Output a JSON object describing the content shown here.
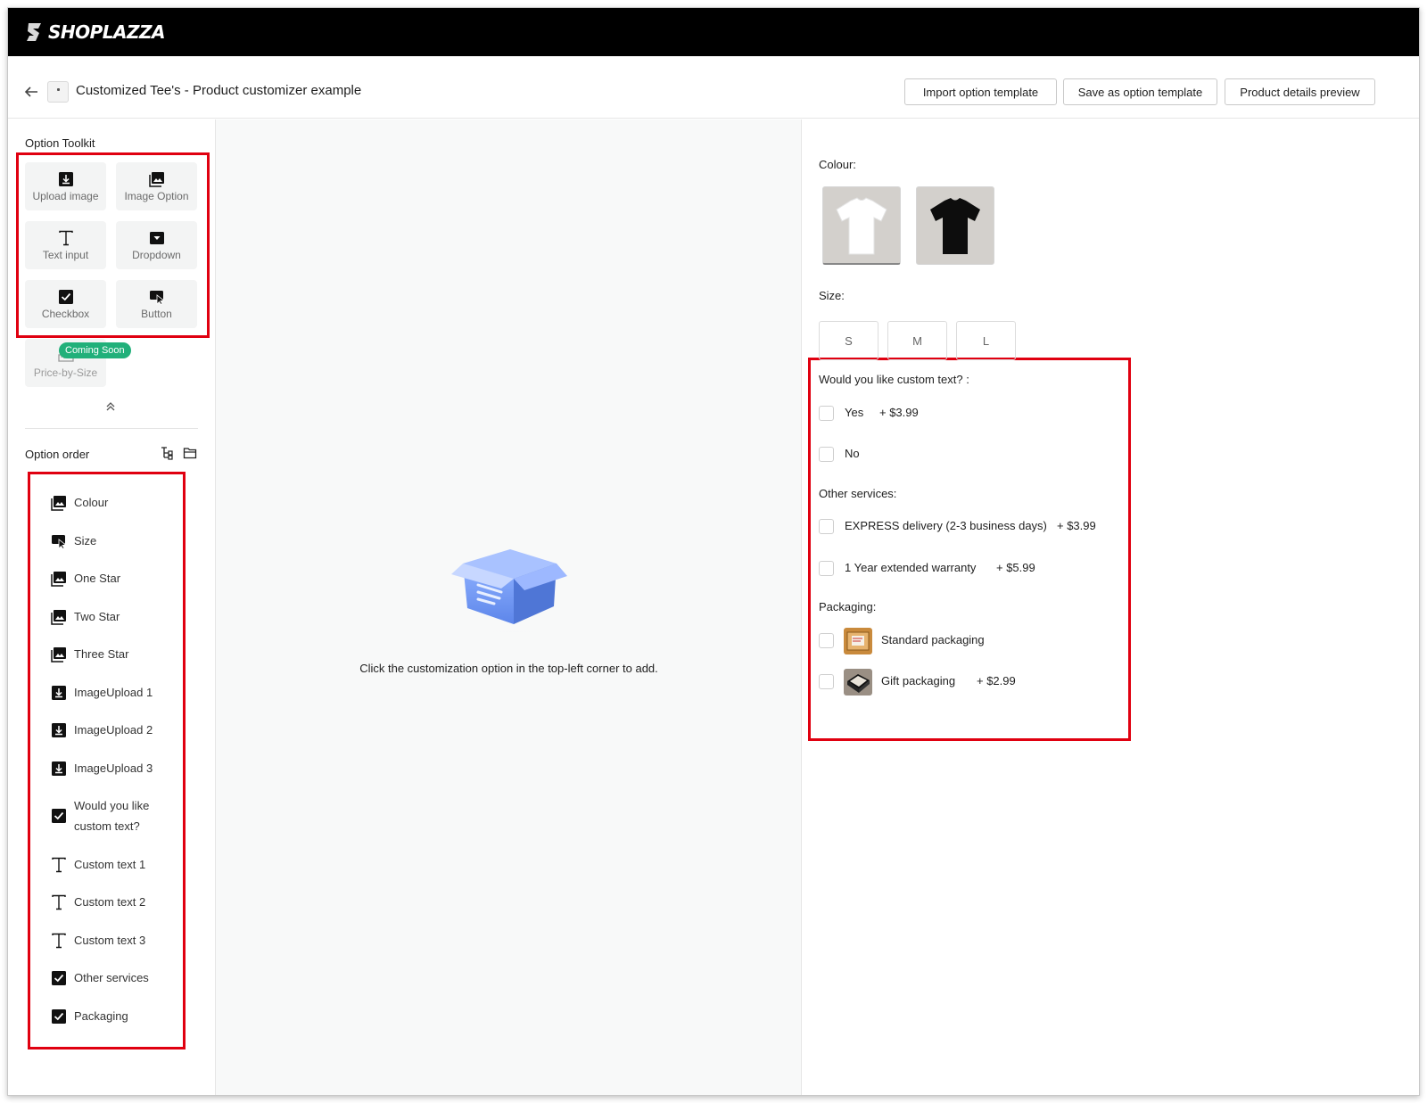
{
  "app": {
    "brand": "SHOPLAZZA",
    "page_title": "Customized Tee's - Product customizer example"
  },
  "header_buttons": {
    "import": "Import option template",
    "save": "Save as option template",
    "preview": "Product details preview"
  },
  "toolkit": {
    "title": "Option Toolkit",
    "tools": [
      {
        "label": "Upload image",
        "icon": "upload-image-icon"
      },
      {
        "label": "Image Option",
        "icon": "image-option-icon"
      },
      {
        "label": "Text input",
        "icon": "text-input-icon"
      },
      {
        "label": "Dropdown",
        "icon": "dropdown-icon"
      },
      {
        "label": "Checkbox",
        "icon": "checkbox-icon"
      },
      {
        "label": "Button",
        "icon": "button-cursor-icon"
      },
      {
        "label": "Price-by-Size",
        "icon": "ruler-icon"
      }
    ],
    "coming_soon": "Coming Soon"
  },
  "option_order": {
    "title": "Option order",
    "items": [
      {
        "label": "Colour",
        "icon": "image-option-icon"
      },
      {
        "label": "Size",
        "icon": "button-cursor-icon"
      },
      {
        "label": "One Star",
        "icon": "image-option-icon"
      },
      {
        "label": "Two Star",
        "icon": "image-option-icon"
      },
      {
        "label": "Three Star",
        "icon": "image-option-icon"
      },
      {
        "label": "ImageUpload 1",
        "icon": "upload-image-icon"
      },
      {
        "label": "ImageUpload 2",
        "icon": "upload-image-icon"
      },
      {
        "label": "ImageUpload 3",
        "icon": "upload-image-icon"
      },
      {
        "label": "Would you like custom text?",
        "icon": "checkbox-icon"
      },
      {
        "label": "Custom text 1",
        "icon": "text-input-icon"
      },
      {
        "label": "Custom text 2",
        "icon": "text-input-icon"
      },
      {
        "label": "Custom text 3",
        "icon": "text-input-icon"
      },
      {
        "label": "Other services",
        "icon": "checkbox-icon"
      },
      {
        "label": "Packaging",
        "icon": "checkbox-icon"
      }
    ]
  },
  "canvas": {
    "empty_message": "Click the customization option in the top-left corner to add."
  },
  "preview": {
    "colour_label": "Colour:",
    "colours": [
      "white",
      "black"
    ],
    "size_label": "Size:",
    "sizes": [
      "S",
      "M",
      "L"
    ],
    "custom_text": {
      "label": "Would you like custom text? :",
      "options": [
        {
          "text": "Yes",
          "price": "+ $3.99"
        },
        {
          "text": "No",
          "price": ""
        }
      ]
    },
    "other_services": {
      "label": "Other services:",
      "options": [
        {
          "text": "EXPRESS delivery (2-3 business days)",
          "price": "+ $3.99"
        },
        {
          "text": "1 Year extended warranty",
          "price": "+ $5.99"
        }
      ]
    },
    "packaging": {
      "label": "Packaging:",
      "options": [
        {
          "text": "Standard packaging",
          "price": ""
        },
        {
          "text": "Gift packaging",
          "price": "+ $2.99"
        }
      ]
    }
  },
  "colors": {
    "highlight": "#e00010",
    "badge": "#21b07a"
  }
}
